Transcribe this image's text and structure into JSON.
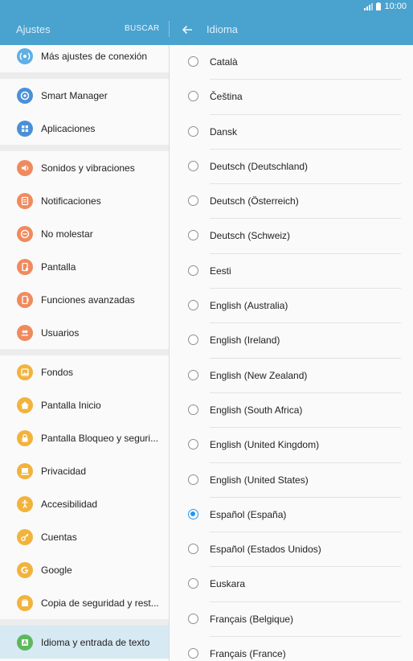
{
  "status": {
    "time": "10:00"
  },
  "header": {
    "left_title": "Ajustes",
    "search_label": "BUSCAR",
    "right_title": "Idioma"
  },
  "colors": {
    "accent": "#4aa2cf",
    "radio_selected": "#2196f3"
  },
  "sidebar": {
    "groups": [
      {
        "items": [
          {
            "label": "Más ajustes de conexión",
            "icon": "more-connections-icon",
            "color": "#5eb0e5"
          }
        ]
      },
      {
        "items": [
          {
            "label": "Smart Manager",
            "icon": "smart-manager-icon",
            "color": "#4a90d9"
          },
          {
            "label": "Aplicaciones",
            "icon": "apps-icon",
            "color": "#4a90d9"
          }
        ]
      },
      {
        "items": [
          {
            "label": "Sonidos y vibraciones",
            "icon": "sound-icon",
            "color": "#f08a5d"
          },
          {
            "label": "Notificaciones",
            "icon": "notifications-icon",
            "color": "#f08a5d"
          },
          {
            "label": "No molestar",
            "icon": "do-not-disturb-icon",
            "color": "#f08a5d"
          },
          {
            "label": "Pantalla",
            "icon": "display-icon",
            "color": "#f08a5d"
          },
          {
            "label": "Funciones avanzadas",
            "icon": "advanced-features-icon",
            "color": "#f08a5d"
          },
          {
            "label": "Usuarios",
            "icon": "users-icon",
            "color": "#f08a5d"
          }
        ]
      },
      {
        "items": [
          {
            "label": "Fondos",
            "icon": "wallpaper-icon",
            "color": "#f2b33d"
          },
          {
            "label": "Pantalla Inicio",
            "icon": "home-icon",
            "color": "#f2b33d"
          },
          {
            "label": "Pantalla Bloqueo y seguri...",
            "icon": "lock-icon",
            "color": "#f2b33d"
          },
          {
            "label": "Privacidad",
            "icon": "privacy-icon",
            "color": "#f2b33d"
          },
          {
            "label": "Accesibilidad",
            "icon": "accessibility-icon",
            "color": "#f2b33d"
          },
          {
            "label": "Cuentas",
            "icon": "key-icon",
            "color": "#f2b33d"
          },
          {
            "label": "Google",
            "icon": "google-icon",
            "color": "#f2b33d"
          },
          {
            "label": "Copia de seguridad y rest...",
            "icon": "backup-icon",
            "color": "#f2b33d"
          }
        ]
      },
      {
        "items": [
          {
            "label": "Idioma y entrada de texto",
            "icon": "language-input-icon",
            "color": "#5cb85c",
            "selected": true
          }
        ]
      }
    ]
  },
  "languages": [
    {
      "label": "Català"
    },
    {
      "label": "Čeština"
    },
    {
      "label": "Dansk"
    },
    {
      "label": "Deutsch (Deutschland)"
    },
    {
      "label": "Deutsch (Österreich)"
    },
    {
      "label": "Deutsch (Schweiz)"
    },
    {
      "label": "Eesti"
    },
    {
      "label": "English (Australia)"
    },
    {
      "label": "English (Ireland)"
    },
    {
      "label": "English (New Zealand)"
    },
    {
      "label": "English (South Africa)"
    },
    {
      "label": "English (United Kingdom)"
    },
    {
      "label": "English (United States)"
    },
    {
      "label": "Español (España)",
      "checked": true
    },
    {
      "label": "Español (Estados Unidos)"
    },
    {
      "label": "Euskara"
    },
    {
      "label": "Français (Belgique)"
    },
    {
      "label": "Français (France)"
    }
  ]
}
